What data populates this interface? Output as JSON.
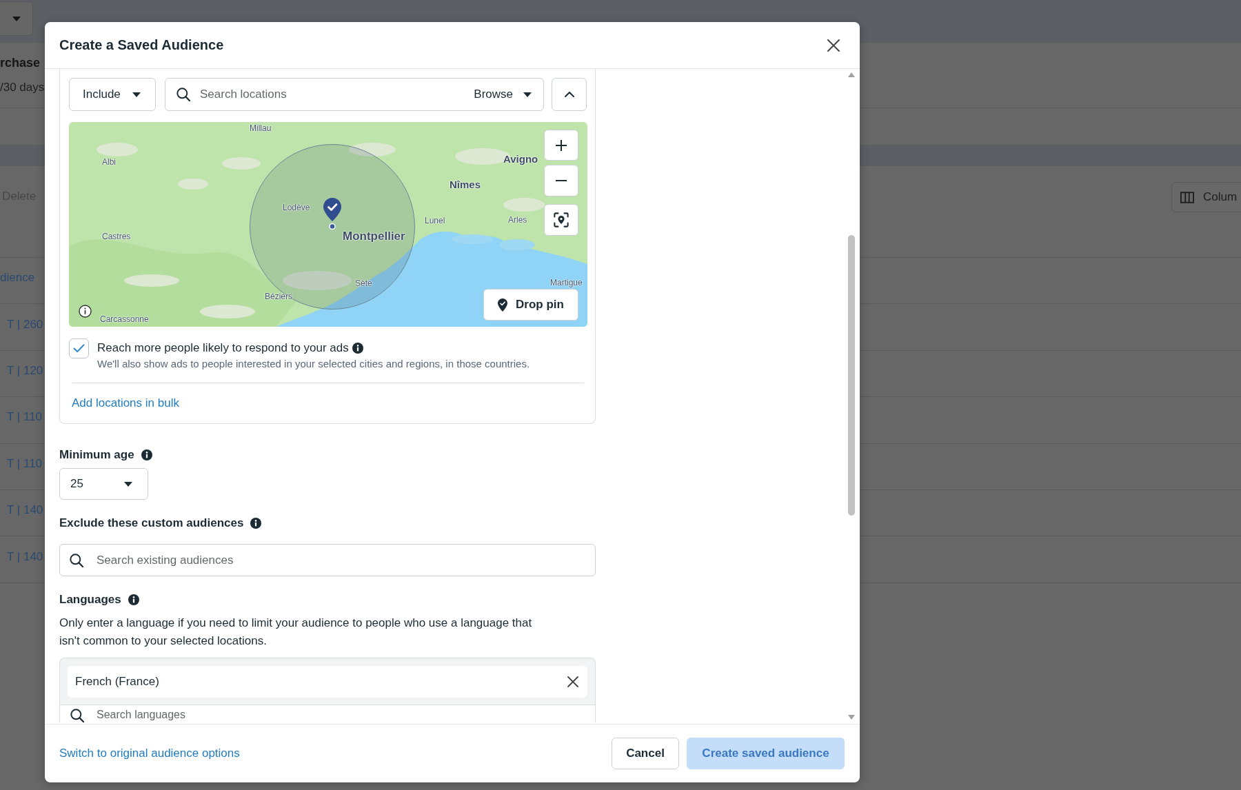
{
  "background_page": {
    "heading": "rchase",
    "subheading": "/30 days",
    "delete_button": "Delete",
    "columns_button": "Colum",
    "rows": [
      "dience",
      "T | 260",
      "T | 120",
      "T | 110",
      "T | 110",
      "T | 140",
      "T | 140"
    ]
  },
  "dialog": {
    "title": "Create a Saved Audience",
    "location": {
      "mode": "Include",
      "search": {
        "placeholder": "Search locations"
      },
      "browse": "Browse",
      "expanded": true,
      "map": {
        "labels": [
          {
            "text": "Millau",
            "kind": "town"
          },
          {
            "text": "Albi",
            "kind": "town"
          },
          {
            "text": "Castres",
            "kind": "town"
          },
          {
            "text": "Lodève",
            "kind": "town"
          },
          {
            "text": "Montpellier",
            "kind": "city"
          },
          {
            "text": "Nîmes",
            "kind": "city"
          },
          {
            "text": "Avigno",
            "kind": "city"
          },
          {
            "text": "Lunel",
            "kind": "town"
          },
          {
            "text": "Arles",
            "kind": "town"
          },
          {
            "text": "Sète",
            "kind": "town"
          },
          {
            "text": "Béziers",
            "kind": "town"
          },
          {
            "text": "Carcassonne",
            "kind": "town"
          },
          {
            "text": "Martigue",
            "kind": "town"
          }
        ],
        "drop_pin": "Drop pin"
      },
      "reach_more": {
        "checked": true,
        "label": "Reach more people likely to respond to your ads",
        "note": "We'll also show ads to people interested in your selected cities and regions, in those countries."
      },
      "bulk_link": "Add locations in bulk"
    },
    "minimum_age": {
      "label": "Minimum age",
      "value": "25"
    },
    "exclude": {
      "label": "Exclude these custom audiences",
      "search": {
        "placeholder": "Search existing audiences"
      }
    },
    "languages": {
      "label": "Languages",
      "help": "Only enter a language if you need to limit your audience to people who use a language that isn't common to your selected locations.",
      "chips": [
        "French (France)"
      ],
      "search": {
        "placeholder": "Search languages"
      }
    },
    "footer": {
      "switch_link": "Switch to original audience options",
      "cancel": "Cancel",
      "create": {
        "label": "Create saved audience",
        "disabled": true
      }
    }
  }
}
